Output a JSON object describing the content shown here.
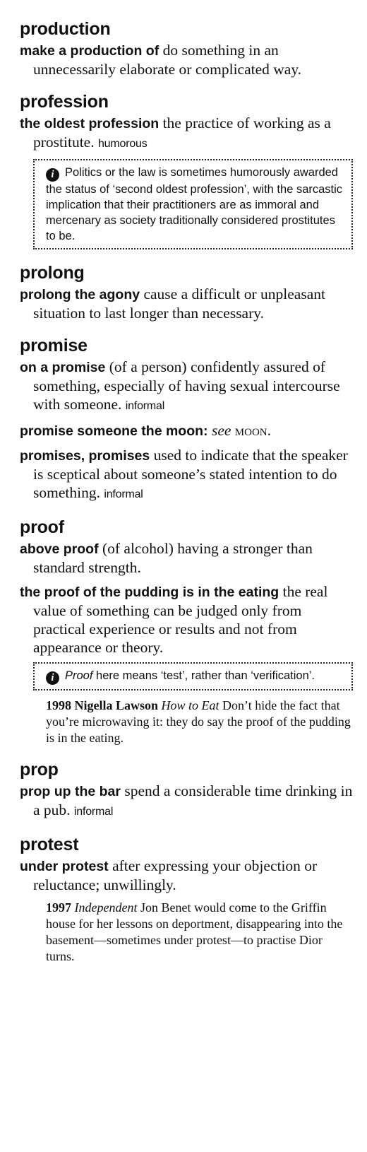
{
  "entries": [
    {
      "headword": "production",
      "idioms": [
        {
          "phrase": "make a production of",
          "definition": " do something in an unnecessarily elaborate or complicated way."
        }
      ]
    },
    {
      "headword": "profession",
      "idioms": [
        {
          "phrase": "the oldest profession",
          "definition": " the practice of working as a prostitute. ",
          "label": "humorous"
        }
      ],
      "note": "Politics or the law is sometimes humorously awarded the status of ‘second oldest profession’, with the sarcastic implication that their practitioners are as immoral and mercenary as society traditionally considered prostitutes to be."
    },
    {
      "headword": "prolong",
      "idioms": [
        {
          "phrase": "prolong the agony",
          "definition": " cause a difficult or unpleasant situation to last longer than necessary."
        }
      ]
    },
    {
      "headword": "promise",
      "idioms": [
        {
          "phrase": "on a promise",
          "definition": " (of a person) confidently assured of something, especially of having sexual intercourse with someone. ",
          "label": "informal"
        },
        {
          "phrase": "promise someone the moon",
          "colon": ": ",
          "see": "see",
          "ref": "moon."
        },
        {
          "phrase": "promises, promises",
          "definition": " used to indicate that the speaker is sceptical about someone’s stated intention to do something. ",
          "label": "informal"
        }
      ]
    },
    {
      "headword": "proof",
      "idioms": [
        {
          "phrase": "above proof",
          "definition": " (of alcohol) having a stronger than standard strength."
        },
        {
          "phrase": "the proof of the pudding is in the eating",
          "definition": " the real value of something can be judged only from practical experience or results and not from appearance or theory."
        }
      ],
      "note_em": "Proof",
      "note_rest": " here means ‘test’, rather than ‘verification’.",
      "quote": {
        "year": "1998",
        "author": " Nigella Lawson ",
        "title": "How to Eat",
        "text": " Don’t hide the fact that you’re microwaving it: they do say the proof of the pudding is in the eating."
      }
    },
    {
      "headword": "prop",
      "idioms": [
        {
          "phrase": "prop up the bar",
          "definition": " spend a considerable time drinking in a pub. ",
          "label": "informal"
        }
      ]
    },
    {
      "headword": "protest",
      "idioms": [
        {
          "phrase": "under protest",
          "definition": " after expressing your objection or reluctance; unwillingly."
        }
      ],
      "quote": {
        "year": "1997",
        "title": " Independent",
        "text": " Jon Benet would come to the Griffin house for her lessons on deportment, disappearing into the basement—sometimes under protest—to practise Dior turns."
      }
    }
  ]
}
